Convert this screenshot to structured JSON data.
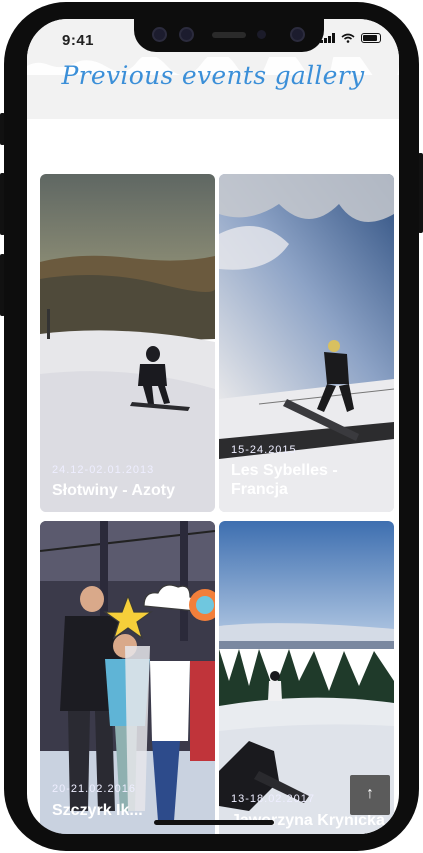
{
  "status": {
    "time": "9:41"
  },
  "page": {
    "title": "Previous events gallery"
  },
  "events": [
    {
      "date": "24.12-02.01.2013",
      "name": "Słotwiny - Azoty"
    },
    {
      "date": "15-24.2015",
      "name": "Les Sybelles - Francja"
    },
    {
      "date": "20-21.02.2016",
      "name": "Szczyrk Ik..."
    },
    {
      "date": "13-18.02.2017",
      "name": "Jaworzyna Krynicka"
    }
  ],
  "controls": {
    "scroll_top_icon": "arrow-up-icon",
    "scroll_top_symbol": "↑"
  },
  "colors": {
    "title": "#3b8fd8",
    "header_bg": "#f2f2f2",
    "frame": "#0d0d0d"
  }
}
